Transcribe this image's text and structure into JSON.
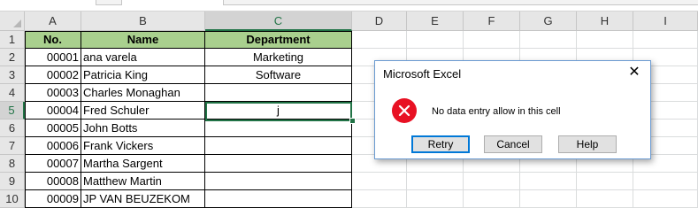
{
  "columns": [
    "A",
    "B",
    "C",
    "D",
    "E",
    "F",
    "G",
    "H",
    "I"
  ],
  "selected_column": "C",
  "rows": [
    "1",
    "2",
    "3",
    "4",
    "5",
    "6",
    "7",
    "8",
    "9",
    "10"
  ],
  "selected_row": "5",
  "table": {
    "headers": [
      "No.",
      "Name",
      "Department"
    ],
    "data": [
      [
        "00001",
        "ana varela",
        "Marketing"
      ],
      [
        "00002",
        "Patricia King",
        "Software"
      ],
      [
        "00003",
        "Charles Monaghan",
        ""
      ],
      [
        "00004",
        "Fred Schuler",
        "j"
      ],
      [
        "00005",
        "John Botts",
        ""
      ],
      [
        "00006",
        "Frank Vickers",
        ""
      ],
      [
        "00007",
        "Martha Sargent",
        ""
      ],
      [
        "00008",
        "Matthew Martin",
        ""
      ],
      [
        "00009",
        "JP VAN BEUZEKOM",
        ""
      ]
    ]
  },
  "dialog": {
    "title": "Microsoft Excel",
    "close_glyph": "✕",
    "icon": "error-icon",
    "message": "No data entry allow in this cell",
    "buttons": [
      "Retry",
      "Cancel",
      "Help"
    ]
  },
  "colors": {
    "header_fill": "#a9d08e",
    "selection": "#217346",
    "error": "#e81123",
    "dialog_focus": "#0078d7"
  }
}
